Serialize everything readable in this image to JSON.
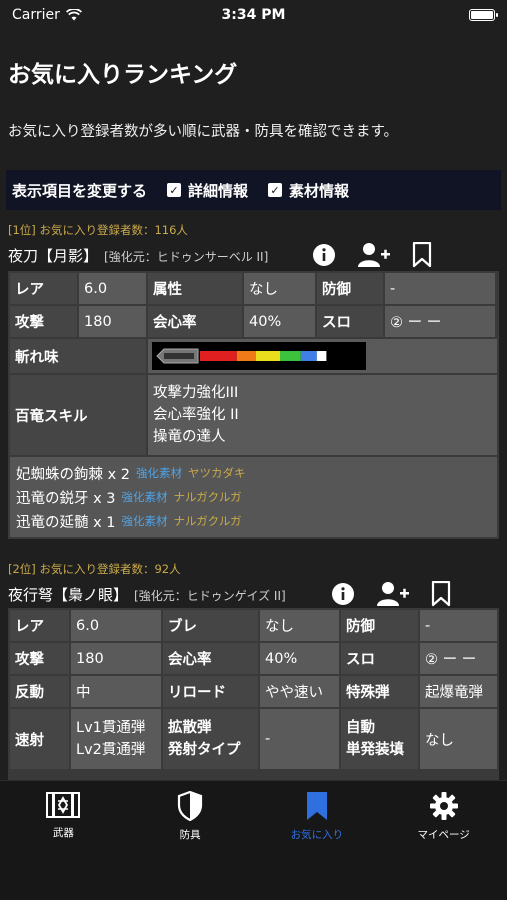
{
  "status": {
    "carrier": "Carrier",
    "time": "3:34 PM"
  },
  "page": {
    "title": "お気に入りランキング",
    "description": "お気に入り登録者数が多い順に武器・防具を確認できます。"
  },
  "options": {
    "label": "表示項目を変更する",
    "detail": "詳細情報",
    "material": "素材情報"
  },
  "item1": {
    "rank": "[1位] お気に入り登録者数：116人",
    "name": "夜刀【月影】",
    "base": "[強化元：ヒドゥンサーベル II]",
    "rows": [
      [
        "レア",
        "6.0",
        "属性",
        "なし",
        "防御",
        "-"
      ],
      [
        "攻撃",
        "180",
        "会心率",
        "40%",
        "スロ",
        "② ー ー"
      ]
    ],
    "sharpness_label": "斬れ味",
    "sharpness": [
      {
        "color": "#e02020",
        "amount": 0.23
      },
      {
        "color": "#f07a18",
        "amount": 0.12
      },
      {
        "color": "#eadd1e",
        "amount": 0.15
      },
      {
        "color": "#3cc23c",
        "amount": 0.13
      },
      {
        "color": "#3f7fe6",
        "amount": 0.1
      },
      {
        "color": "#ffffff",
        "amount": 0.06
      }
    ],
    "skills_label": "百竜スキル",
    "skills": [
      "攻撃力強化III",
      "会心率強化 II",
      "操竜の達人"
    ],
    "materials": [
      {
        "name": "妃蜘蛛の鉤棘 x 2",
        "category": "強化素材",
        "source": "ヤツカダキ"
      },
      {
        "name": "迅竜の鋭牙 x 3",
        "category": "強化素材",
        "source": "ナルガクルガ"
      },
      {
        "name": "迅竜の延髄 x 1",
        "category": "強化素材",
        "source": "ナルガクルガ"
      }
    ]
  },
  "item2": {
    "rank": "[2位] お気に入り登録者数：92人",
    "name": "夜行弩【梟ノ眼】",
    "base": "[強化元：ヒドゥンゲイズ II]",
    "rows": [
      [
        "レア",
        "6.0",
        "ブレ",
        "なし",
        "防御",
        "-"
      ],
      [
        "攻撃",
        "180",
        "会心率",
        "40%",
        "スロ",
        "② ー ー"
      ],
      [
        "反動",
        "中",
        "リロード",
        "やや速い",
        "特殊弾",
        "起爆竜弾"
      ]
    ],
    "rapid": {
      "label": "速射",
      "values": [
        "Lv1貫通弾",
        "Lv2貫通弾"
      ],
      "spread_label_1": "拡散弾",
      "spread_label_2": "発射タイプ",
      "spread_value": "-",
      "auto_label_1": "自動",
      "auto_label_2": "単発装填",
      "auto_value": "なし"
    }
  },
  "tabs": [
    {
      "label": "武器",
      "icon": "weapon-icon"
    },
    {
      "label": "防具",
      "icon": "armor-icon"
    },
    {
      "label": "お気に入り",
      "icon": "bookmark-icon",
      "active": true
    },
    {
      "label": "マイページ",
      "icon": "gear-icon"
    }
  ],
  "colors": {
    "accent": "#2f6fe0",
    "rank": "#c9a94a",
    "category": "#4fa3e6",
    "option_bar": "#111425"
  }
}
